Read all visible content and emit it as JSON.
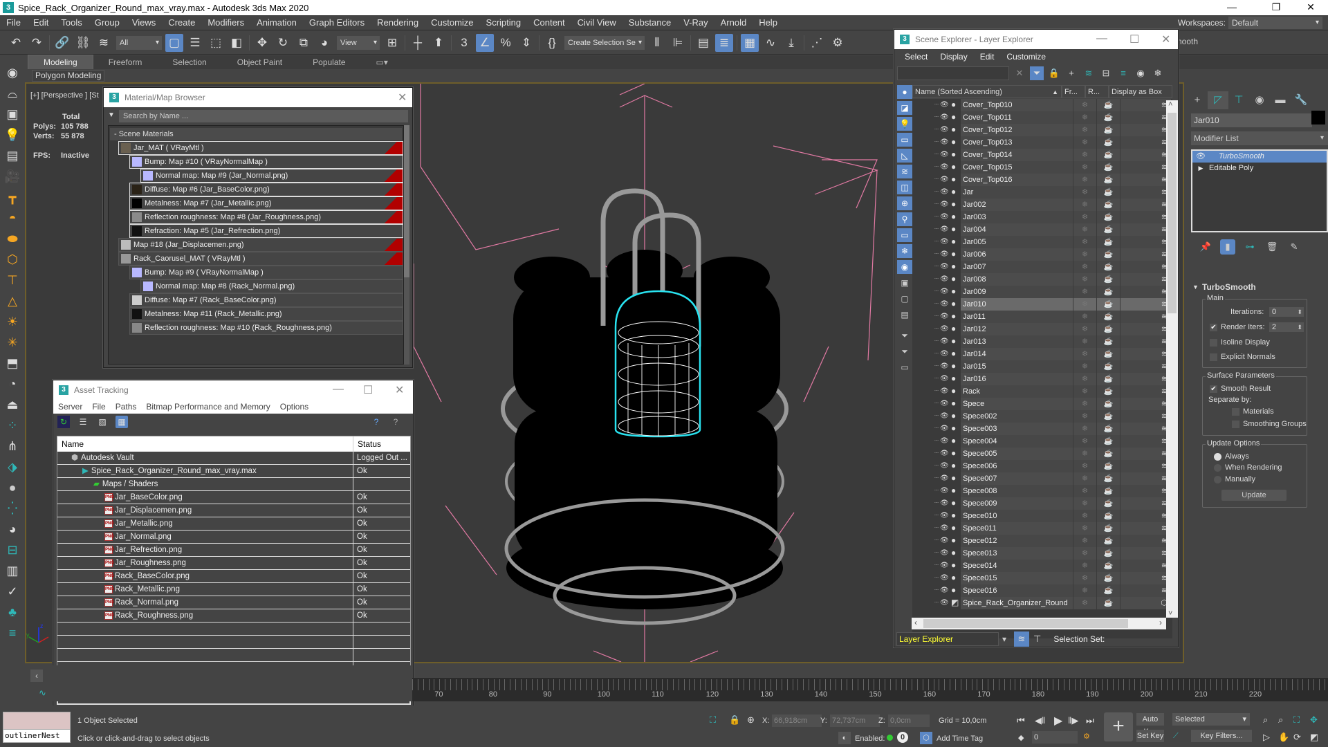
{
  "window": {
    "title": "Spice_Rack_Organizer_Round_max_vray.max - Autodesk 3ds Max 2020",
    "app_icon": "3"
  },
  "menubar": {
    "items": [
      "File",
      "Edit",
      "Tools",
      "Group",
      "Views",
      "Create",
      "Modifiers",
      "Animation",
      "Graph Editors",
      "Rendering",
      "Customize",
      "Scripting",
      "Content",
      "Civil View",
      "Substance",
      "V-Ray",
      "Arnold",
      "Help"
    ],
    "workspaces_label": "Workspaces:",
    "workspaces_value": "Default"
  },
  "toolbar": {
    "selection_filter": "All",
    "ref_coord": "View",
    "named_selection": "Create Selection Se",
    "overflow_text": "nooth"
  },
  "ribbon": {
    "tabs": [
      "Modeling",
      "Freeform",
      "Selection",
      "Object Paint",
      "Populate"
    ],
    "active_tab": "Modeling",
    "panel_label": "Polygon Modeling"
  },
  "viewport": {
    "label": "[+] [Perspective ] [St",
    "stats": {
      "header": "Total",
      "polys_label": "Polys:",
      "polys": "105 788",
      "verts_label": "Verts:",
      "verts": "55 878",
      "fps_label": "FPS:",
      "fps": "Inactive"
    }
  },
  "material_browser": {
    "title": "Material/Map Browser",
    "search_placeholder": "Search by Name ...",
    "section": "- Scene Materials",
    "items": [
      {
        "label": "Jar_MAT  ( VRayMtl )",
        "level": 0,
        "swatch": "#6a6050",
        "red": true,
        "sel": true
      },
      {
        "label": "Bump: Map #10  ( VRayNormalMap )",
        "level": 1,
        "swatch": "#b8b8ff",
        "red": false,
        "sel": true
      },
      {
        "label": "Normal map: Map #9 (Jar_Normal.png)",
        "level": 2,
        "swatch": "#b8b8ff",
        "red": true,
        "sel": true
      },
      {
        "label": "Diffuse: Map #6 (Jar_BaseColor.png)",
        "level": 1,
        "swatch": "#2a2216",
        "red": true,
        "sel": true
      },
      {
        "label": "Metalness: Map #7 (Jar_Metallic.png)",
        "level": 1,
        "swatch": "#000000",
        "red": true,
        "sel": true
      },
      {
        "label": "Reflection roughness: Map #8 (Jar_Roughness.png)",
        "level": 1,
        "swatch": "#8a8a8a",
        "red": true,
        "sel": true
      },
      {
        "label": "Refraction: Map #5 (Jar_Refrection.png)",
        "level": 1,
        "swatch": "#111111",
        "red": false,
        "sel": true
      },
      {
        "label": "Map #18 (Jar_Displacemen.png)",
        "level": 0,
        "swatch": "#bbbbbb",
        "red": true,
        "sel": false
      },
      {
        "label": "Rack_Caorusel_MAT  ( VRayMtl )",
        "level": 0,
        "swatch": "#999999",
        "red": true,
        "sel": false
      },
      {
        "label": "Bump: Map #9  ( VRayNormalMap )",
        "level": 1,
        "swatch": "#b8b8ff",
        "red": false,
        "sel": false
      },
      {
        "label": "Normal map: Map #8 (Rack_Normal.png)",
        "level": 2,
        "swatch": "#b8b8ff",
        "red": false,
        "sel": false
      },
      {
        "label": "Diffuse: Map #7 (Rack_BaseColor.png)",
        "level": 1,
        "swatch": "#cccccc",
        "red": false,
        "sel": false
      },
      {
        "label": "Metalness: Map #11 (Rack_Metallic.png)",
        "level": 1,
        "swatch": "#111111",
        "red": false,
        "sel": false
      },
      {
        "label": "Reflection roughness: Map #10 (Rack_Roughness.png)",
        "level": 1,
        "swatch": "#888888",
        "red": false,
        "sel": false
      }
    ]
  },
  "asset_tracking": {
    "title": "Asset Tracking",
    "menu": [
      "Server",
      "File",
      "Paths",
      "Bitmap Performance and Memory",
      "Options"
    ],
    "col_name": "Name",
    "col_status": "Status",
    "rows": [
      {
        "name": "Autodesk Vault",
        "status": "Logged Out ...",
        "level": 1,
        "icon": "vault"
      },
      {
        "name": "Spice_Rack_Organizer_Round_max_vray.max",
        "status": "Ok",
        "level": 2,
        "icon": "max"
      },
      {
        "name": "Maps / Shaders",
        "status": "",
        "level": 3,
        "icon": "maps"
      },
      {
        "name": "Jar_BaseColor.png",
        "status": "Ok",
        "level": 4,
        "icon": "png"
      },
      {
        "name": "Jar_Displacemen.png",
        "status": "Ok",
        "level": 4,
        "icon": "png"
      },
      {
        "name": "Jar_Metallic.png",
        "status": "Ok",
        "level": 4,
        "icon": "png"
      },
      {
        "name": "Jar_Normal.png",
        "status": "Ok",
        "level": 4,
        "icon": "png"
      },
      {
        "name": "Jar_Refrection.png",
        "status": "Ok",
        "level": 4,
        "icon": "png"
      },
      {
        "name": "Jar_Roughness.png",
        "status": "Ok",
        "level": 4,
        "icon": "png"
      },
      {
        "name": "Rack_BaseColor.png",
        "status": "Ok",
        "level": 4,
        "icon": "png"
      },
      {
        "name": "Rack_Metallic.png",
        "status": "Ok",
        "level": 4,
        "icon": "png"
      },
      {
        "name": "Rack_Normal.png",
        "status": "Ok",
        "level": 4,
        "icon": "png"
      },
      {
        "name": "Rack_Roughness.png",
        "status": "Ok",
        "level": 4,
        "icon": "png"
      },
      {
        "name": "",
        "status": "",
        "level": 0,
        "icon": ""
      },
      {
        "name": "",
        "status": "",
        "level": 0,
        "icon": ""
      },
      {
        "name": "",
        "status": "",
        "level": 0,
        "icon": ""
      },
      {
        "name": "",
        "status": "",
        "level": 0,
        "icon": ""
      }
    ]
  },
  "scene_explorer": {
    "title": "Scene Explorer - Layer Explorer",
    "menu": [
      "Select",
      "Display",
      "Edit",
      "Customize"
    ],
    "col_name": "Name (Sorted Ascending)",
    "col_freeze": "Fr...",
    "col_render": "R...",
    "col_box": "Display as Box",
    "rows": [
      "Cover_Top010",
      "Cover_Top011",
      "Cover_Top012",
      "Cover_Top013",
      "Cover_Top014",
      "Cover_Top015",
      "Cover_Top016",
      "Jar",
      "Jar002",
      "Jar003",
      "Jar004",
      "Jar005",
      "Jar006",
      "Jar007",
      "Jar008",
      "Jar009",
      "Jar010",
      "Jar011",
      "Jar012",
      "Jar013",
      "Jar014",
      "Jar015",
      "Jar016",
      "Rack",
      "Spece",
      "Spece002",
      "Spece003",
      "Spece004",
      "Spece005",
      "Spece006",
      "Spece007",
      "Spece008",
      "Spece009",
      "Spece010",
      "Spece011",
      "Spece012",
      "Spece013",
      "Spece014",
      "Spece015",
      "Spece016",
      "Spice_Rack_Organizer_Round"
    ],
    "selected": "Jar010",
    "bottom_dropdown": "Layer Explorer",
    "selection_set_label": "Selection Set:"
  },
  "command_panel": {
    "object_name": "Jar010",
    "object_color": "#000000",
    "modifier_list": "Modifier List",
    "stack": [
      {
        "label": "TurboSmooth",
        "active": true
      },
      {
        "label": "Editable Poly",
        "active": false
      }
    ],
    "rollout": {
      "title": "TurboSmooth",
      "main_group": "Main",
      "iterations_label": "Iterations:",
      "iterations": "0",
      "render_iters_label": "Render Iters:",
      "render_iters": "2",
      "render_iters_checked": true,
      "isoline_label": "Isoline Display",
      "isoline_checked": false,
      "explicit_label": "Explicit Normals",
      "explicit_checked": false,
      "surface_group": "Surface Parameters",
      "smooth_result_label": "Smooth Result",
      "smooth_result_checked": true,
      "separate_by_label": "Separate by:",
      "materials_label": "Materials",
      "smoothing_groups_label": "Smoothing Groups",
      "update_group": "Update Options",
      "update_options": [
        "Always",
        "When Rendering",
        "Manually"
      ],
      "update_selected": "Always",
      "update_button": "Update"
    }
  },
  "timeline": {
    "labels": [
      "70",
      "80",
      "90",
      "100",
      "110",
      "120",
      "130",
      "140",
      "150",
      "160",
      "170",
      "180",
      "190",
      "200",
      "210",
      "220"
    ]
  },
  "status": {
    "maxscript_value": "outlinerNest",
    "selected_text": "1 Object Selected",
    "prompt": "Click or click-and-drag to select objects",
    "x_label": "X:",
    "x_value": "66,918cm",
    "y_label": "Y:",
    "y_value": "72,737cm",
    "z_label": "Z:",
    "z_value": "0,0cm",
    "grid": "Grid = 10,0cm",
    "enabled_label": "Enabled:",
    "add_time_tag": "Add Time Tag",
    "frame": "0",
    "auto_key": "Auto Key",
    "set_key": "Set Key",
    "key_mode": "Selected",
    "key_filters": "Key Filters..."
  }
}
